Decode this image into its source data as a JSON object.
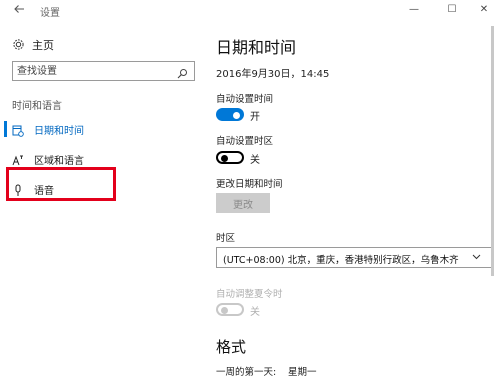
{
  "window": {
    "title": "设置",
    "back_icon": "back-arrow-icon",
    "controls": {
      "minimize": "—",
      "maximize": "☐",
      "close": "✕"
    }
  },
  "sidebar": {
    "home_label": "主页",
    "home_icon": "gear-icon",
    "search_placeholder": "查找设置",
    "search_icon": "search-icon",
    "section_label": "时间和语言",
    "items": [
      {
        "label": "日期和时间",
        "icon": "calendar-clock-icon",
        "active": true
      },
      {
        "label": "区域和语言",
        "icon": "language-icon",
        "active": false,
        "highlighted": true
      },
      {
        "label": "语音",
        "icon": "microphone-icon",
        "active": false
      }
    ],
    "accent_color": "#0078d7",
    "highlight_color": "#e3001b"
  },
  "main": {
    "title": "日期和时间",
    "current_datetime": "2016年9月30日，14:45",
    "auto_time": {
      "label": "自动设置时间",
      "state": "开",
      "on": true
    },
    "auto_timezone": {
      "label": "自动设置时区",
      "state": "关",
      "on": false
    },
    "change_datetime": {
      "label": "更改日期和时间",
      "button": "更改",
      "enabled": false
    },
    "timezone": {
      "label": "时区",
      "value": "(UTC+08:00) 北京，重庆，香港特别行政区，乌鲁木齐"
    },
    "dst": {
      "label": "自动调整夏令时",
      "state": "关",
      "enabled": false
    },
    "format": {
      "title": "格式",
      "first_day_label": "一周的第一天:",
      "first_day_value": "星期一"
    }
  }
}
